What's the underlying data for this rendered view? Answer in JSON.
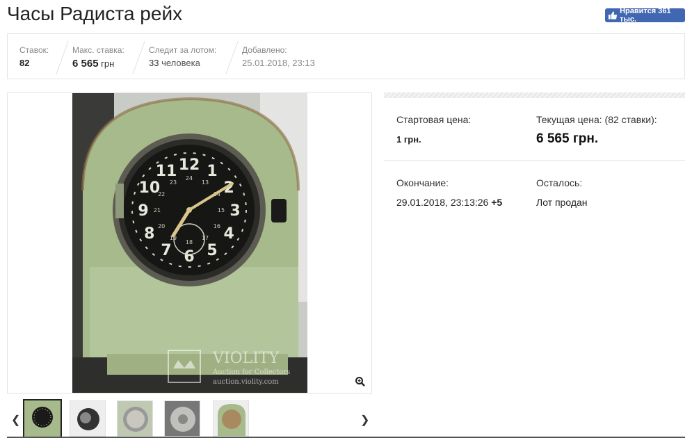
{
  "page_title": "Часы Радиста рейх",
  "fb_like": {
    "label": "Нравится 361 тыс."
  },
  "stats": {
    "bids_label": "Ставок:",
    "bids_value": "82",
    "max_bid_label": "Макс. ставка:",
    "max_bid_value": "6 565",
    "max_bid_currency": " грн",
    "watchers_label": "Следит за лотом:",
    "watchers_value": "33",
    "watchers_suffix": " человека",
    "added_label": "Добавлено:",
    "added_value": "25.01.2018, 23:13"
  },
  "watermark": {
    "brand": "VIOLITY",
    "tagline": "Auction for Collectors",
    "url": "auction.violity.com"
  },
  "dial_numbers": [
    "12",
    "1",
    "2",
    "3",
    "4",
    "5",
    "6",
    "7",
    "8",
    "9",
    "10",
    "11"
  ],
  "dial_inner": [
    "24",
    "13",
    "14",
    "15",
    "16",
    "17",
    "18",
    "19",
    "20",
    "21",
    "22",
    "23"
  ],
  "info": {
    "start_price_label": "Стартовая цена:",
    "start_price_value": "1 грн.",
    "current_price_label": "Текущая цена: (82 ставки):",
    "current_price_value": "6 565 грн.",
    "end_label": "Окончание:",
    "end_value": "29.01.2018, 23:13:26",
    "end_tz": "+5",
    "remaining_label": "Осталось:",
    "remaining_value": "Лот продан"
  },
  "icons": {
    "zoom": "zoom-in-icon",
    "prev": "chevron-left-icon",
    "next": "chevron-right-icon",
    "like": "thumbs-up-icon"
  },
  "colors": {
    "fb_blue": "#4267b2",
    "clock_green": "#a8bc8c"
  }
}
